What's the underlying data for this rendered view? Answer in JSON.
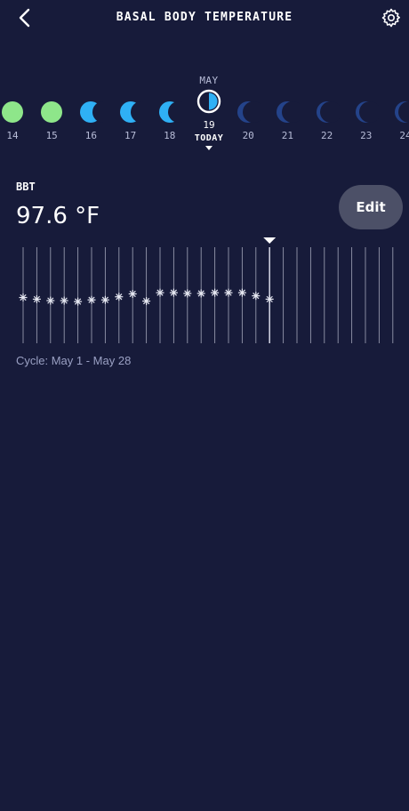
{
  "header": {
    "title": "BASAL BODY TEMPERATURE",
    "back_icon": "chevron-left-icon",
    "settings_icon": "gear-icon"
  },
  "calendar": {
    "month": "MAY",
    "today_label": "TODAY",
    "days": [
      {
        "num": "14",
        "phase": "full",
        "color": "#8ee68a"
      },
      {
        "num": "15",
        "phase": "full",
        "color": "#8ee68a"
      },
      {
        "num": "16",
        "phase": "waning-gibbous",
        "color": "#2fb0f5"
      },
      {
        "num": "17",
        "phase": "waning-gibbous-small",
        "color": "#2fb0f5"
      },
      {
        "num": "18",
        "phase": "last-quarter-plus",
        "color": "#2fb0f5"
      },
      {
        "num": "19",
        "phase": "half",
        "color": "#2fb0f5",
        "today": true
      },
      {
        "num": "20",
        "phase": "crescent",
        "color": "#24438a"
      },
      {
        "num": "21",
        "phase": "crescent",
        "color": "#24438a"
      },
      {
        "num": "22",
        "phase": "crescent-thin",
        "color": "#24438a"
      },
      {
        "num": "23",
        "phase": "crescent-thin",
        "color": "#24438a"
      },
      {
        "num": "24",
        "phase": "crescent-thin",
        "color": "#24438a"
      }
    ]
  },
  "bbt": {
    "label": "BBT",
    "value": "97.6 °F",
    "edit_label": "Edit"
  },
  "chart_data": {
    "type": "scatter",
    "marker": "star",
    "slots": 28,
    "current_index": 18,
    "values": [
      0.35,
      0.28,
      0.22,
      0.22,
      0.18,
      0.25,
      0.25,
      0.38,
      0.5,
      0.2,
      0.55,
      0.55,
      0.52,
      0.52,
      0.55,
      0.55,
      0.55,
      0.42,
      0.28
    ],
    "line_color": "#c9ccdc",
    "marker_color": "#e6e8f2"
  },
  "footer": {
    "cycle_text": "Cycle: May 1 - May 28"
  }
}
